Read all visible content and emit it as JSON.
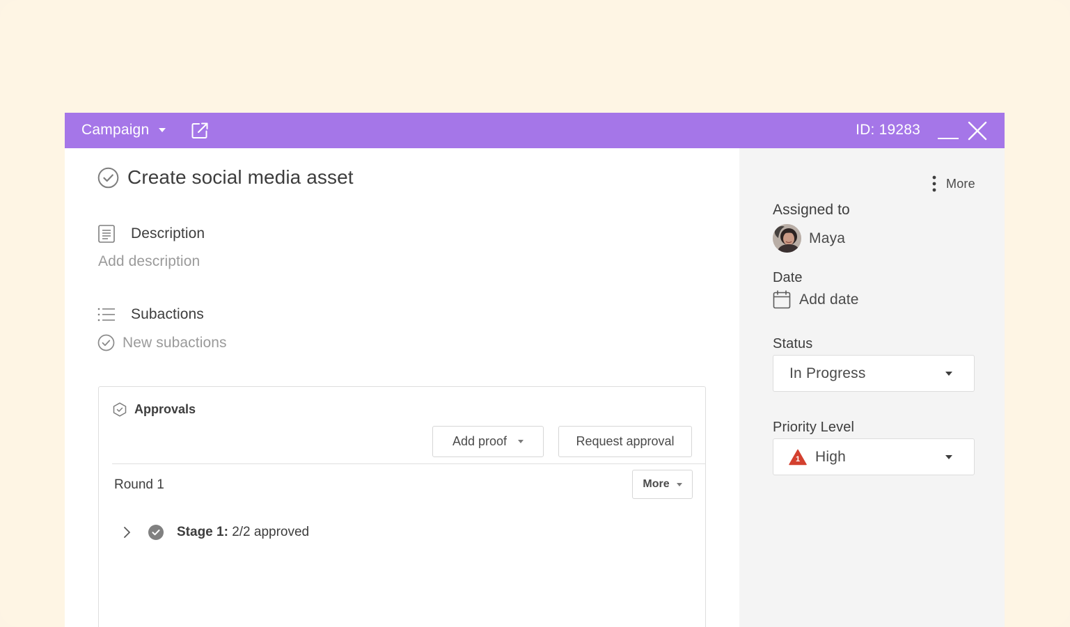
{
  "header": {
    "project_label": "Campaign",
    "id_text": "ID: 19283"
  },
  "task": {
    "title": "Create social media asset"
  },
  "description": {
    "heading": "Description",
    "placeholder": "Add description"
  },
  "subactions": {
    "heading": "Subactions",
    "placeholder": "New subactions"
  },
  "approvals": {
    "heading": "Approvals",
    "add_proof_label": "Add proof",
    "request_approval_label": "Request approval",
    "round_label": "Round 1",
    "round_more_label": "More",
    "stage_label": "Stage 1:",
    "stage_status": "2/2 approved"
  },
  "sidebar": {
    "more_label": "More",
    "assigned_label": "Assigned to",
    "assignee_name": "Maya",
    "date_label": "Date",
    "date_placeholder": "Add date",
    "status_label": "Status",
    "status_value": "In Progress",
    "priority_label": "Priority Level",
    "priority_value": "High",
    "priority_badge": "1"
  },
  "colors": {
    "header_bg": "#a576e8",
    "page_bg": "#fef5e4",
    "sidebar_bg": "#f4f4f4",
    "priority_high": "#d3402f"
  }
}
